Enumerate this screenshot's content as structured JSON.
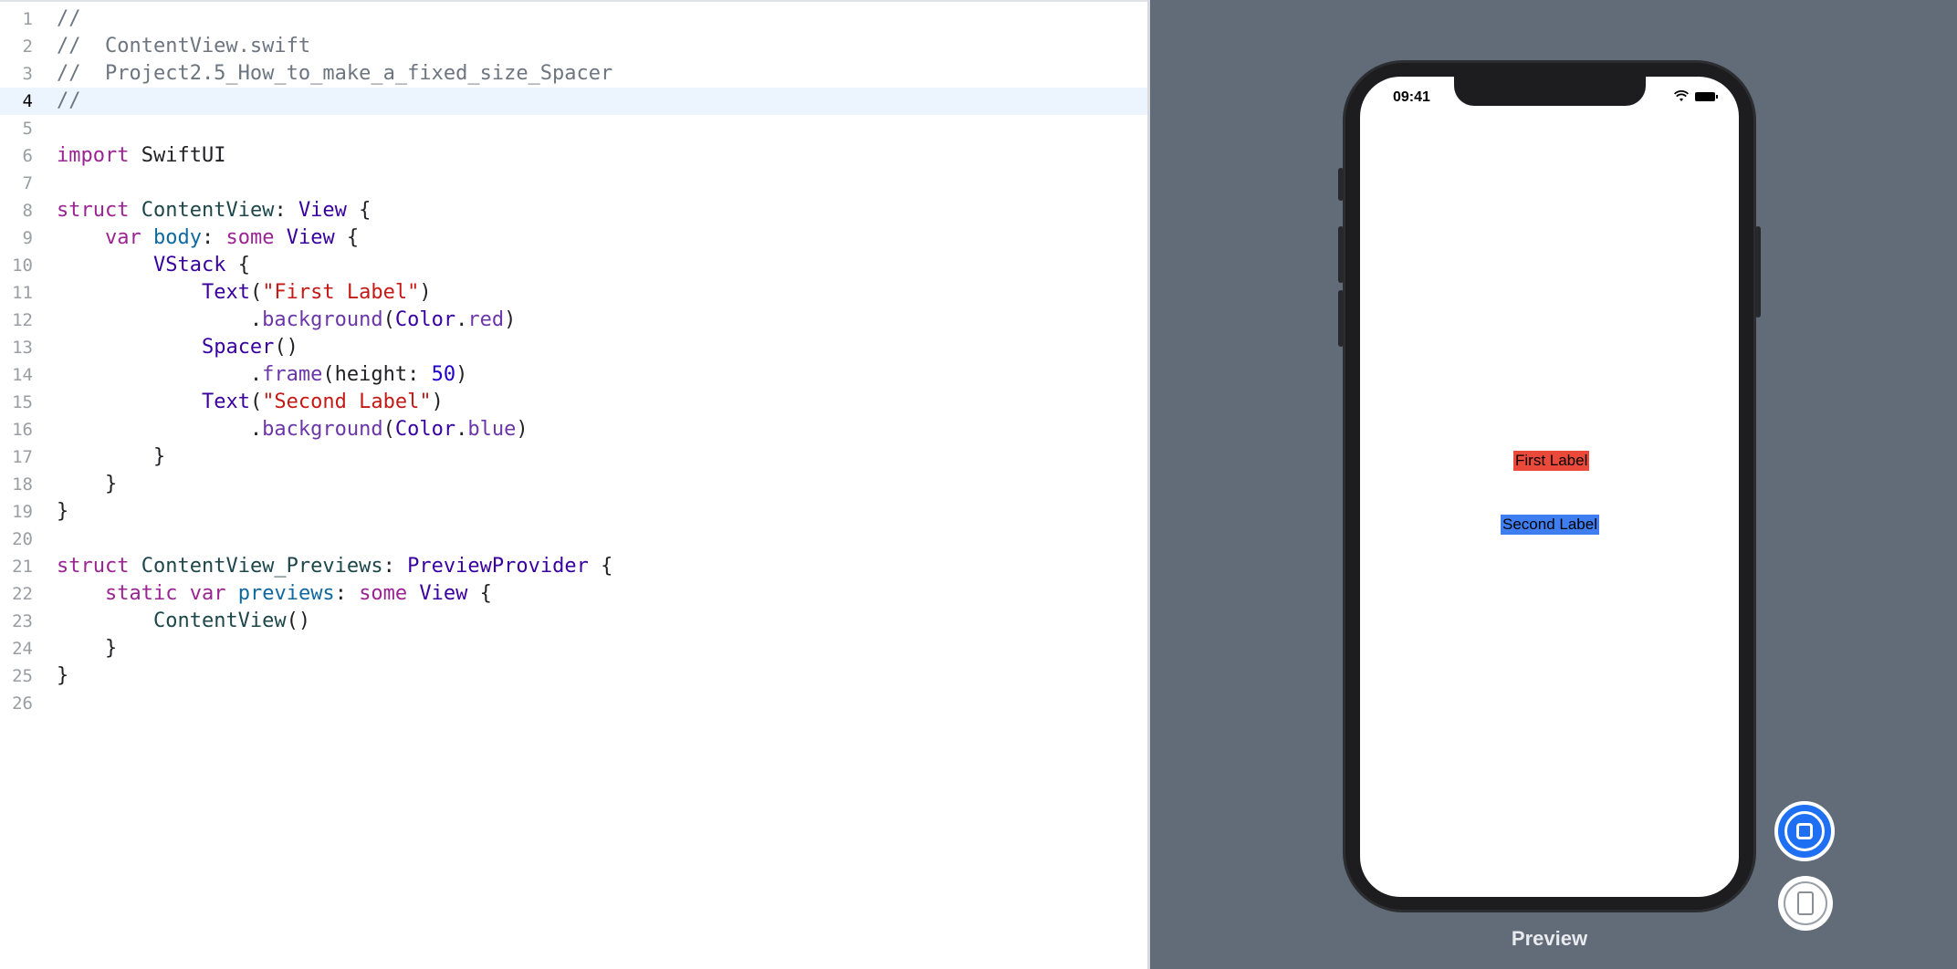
{
  "editor": {
    "current_line": 4,
    "lines": [
      {
        "n": "1",
        "tokens": [
          {
            "t": "comment",
            "v": "//"
          }
        ]
      },
      {
        "n": "2",
        "tokens": [
          {
            "t": "comment",
            "v": "//  ContentView.swift"
          }
        ]
      },
      {
        "n": "3",
        "tokens": [
          {
            "t": "comment",
            "v": "//  Project2.5_How_to_make_a_fixed_size_Spacer"
          }
        ]
      },
      {
        "n": "4",
        "tokens": [
          {
            "t": "comment",
            "v": "//"
          }
        ]
      },
      {
        "n": "5",
        "tokens": []
      },
      {
        "n": "6",
        "tokens": [
          {
            "t": "keyword",
            "v": "import"
          },
          {
            "t": "plain",
            "v": " SwiftUI"
          }
        ]
      },
      {
        "n": "7",
        "tokens": []
      },
      {
        "n": "8",
        "tokens": [
          {
            "t": "keyword",
            "v": "struct"
          },
          {
            "t": "plain",
            "v": " "
          },
          {
            "t": "type",
            "v": "ContentView"
          },
          {
            "t": "plain",
            "v": ": "
          },
          {
            "t": "typeref",
            "v": "View"
          },
          {
            "t": "plain",
            "v": " {"
          }
        ]
      },
      {
        "n": "9",
        "tokens": [
          {
            "t": "plain",
            "v": "    "
          },
          {
            "t": "keyword",
            "v": "var"
          },
          {
            "t": "plain",
            "v": " "
          },
          {
            "t": "prop",
            "v": "body"
          },
          {
            "t": "plain",
            "v": ": "
          },
          {
            "t": "keyword",
            "v": "some"
          },
          {
            "t": "plain",
            "v": " "
          },
          {
            "t": "typeref",
            "v": "View"
          },
          {
            "t": "plain",
            "v": " {"
          }
        ]
      },
      {
        "n": "10",
        "tokens": [
          {
            "t": "plain",
            "v": "        "
          },
          {
            "t": "typeref",
            "v": "VStack"
          },
          {
            "t": "plain",
            "v": " {"
          }
        ]
      },
      {
        "n": "11",
        "tokens": [
          {
            "t": "plain",
            "v": "            "
          },
          {
            "t": "typeref",
            "v": "Text"
          },
          {
            "t": "plain",
            "v": "("
          },
          {
            "t": "string",
            "v": "\"First Label\""
          },
          {
            "t": "plain",
            "v": ")"
          }
        ]
      },
      {
        "n": "12",
        "tokens": [
          {
            "t": "plain",
            "v": "                ."
          },
          {
            "t": "member",
            "v": "background"
          },
          {
            "t": "plain",
            "v": "("
          },
          {
            "t": "typeref",
            "v": "Color"
          },
          {
            "t": "plain",
            "v": "."
          },
          {
            "t": "member",
            "v": "red"
          },
          {
            "t": "plain",
            "v": ")"
          }
        ]
      },
      {
        "n": "13",
        "tokens": [
          {
            "t": "plain",
            "v": "            "
          },
          {
            "t": "typeref",
            "v": "Spacer"
          },
          {
            "t": "plain",
            "v": "()"
          }
        ]
      },
      {
        "n": "14",
        "tokens": [
          {
            "t": "plain",
            "v": "                ."
          },
          {
            "t": "member",
            "v": "frame"
          },
          {
            "t": "plain",
            "v": "(height: "
          },
          {
            "t": "number",
            "v": "50"
          },
          {
            "t": "plain",
            "v": ")"
          }
        ]
      },
      {
        "n": "15",
        "tokens": [
          {
            "t": "plain",
            "v": "            "
          },
          {
            "t": "typeref",
            "v": "Text"
          },
          {
            "t": "plain",
            "v": "("
          },
          {
            "t": "string",
            "v": "\"Second Label\""
          },
          {
            "t": "plain",
            "v": ")"
          }
        ]
      },
      {
        "n": "16",
        "tokens": [
          {
            "t": "plain",
            "v": "                ."
          },
          {
            "t": "member",
            "v": "background"
          },
          {
            "t": "plain",
            "v": "("
          },
          {
            "t": "typeref",
            "v": "Color"
          },
          {
            "t": "plain",
            "v": "."
          },
          {
            "t": "member",
            "v": "blue"
          },
          {
            "t": "plain",
            "v": ")"
          }
        ]
      },
      {
        "n": "17",
        "tokens": [
          {
            "t": "plain",
            "v": "        }"
          }
        ]
      },
      {
        "n": "18",
        "tokens": [
          {
            "t": "plain",
            "v": "    }"
          }
        ]
      },
      {
        "n": "19",
        "tokens": [
          {
            "t": "plain",
            "v": "}"
          }
        ]
      },
      {
        "n": "20",
        "tokens": []
      },
      {
        "n": "21",
        "tokens": [
          {
            "t": "keyword",
            "v": "struct"
          },
          {
            "t": "plain",
            "v": " "
          },
          {
            "t": "type",
            "v": "ContentView_Previews"
          },
          {
            "t": "plain",
            "v": ": "
          },
          {
            "t": "typeref",
            "v": "PreviewProvider"
          },
          {
            "t": "plain",
            "v": " {"
          }
        ]
      },
      {
        "n": "22",
        "tokens": [
          {
            "t": "plain",
            "v": "    "
          },
          {
            "t": "keyword",
            "v": "static"
          },
          {
            "t": "plain",
            "v": " "
          },
          {
            "t": "keyword",
            "v": "var"
          },
          {
            "t": "plain",
            "v": " "
          },
          {
            "t": "prop",
            "v": "previews"
          },
          {
            "t": "plain",
            "v": ": "
          },
          {
            "t": "keyword",
            "v": "some"
          },
          {
            "t": "plain",
            "v": " "
          },
          {
            "t": "typeref",
            "v": "View"
          },
          {
            "t": "plain",
            "v": " {"
          }
        ]
      },
      {
        "n": "23",
        "tokens": [
          {
            "t": "plain",
            "v": "        "
          },
          {
            "t": "type",
            "v": "ContentView"
          },
          {
            "t": "plain",
            "v": "()"
          }
        ]
      },
      {
        "n": "24",
        "tokens": [
          {
            "t": "plain",
            "v": "    }"
          }
        ]
      },
      {
        "n": "25",
        "tokens": [
          {
            "t": "plain",
            "v": "}"
          }
        ]
      },
      {
        "n": "26",
        "tokens": []
      }
    ]
  },
  "preview": {
    "device": {
      "status_time": "09:41",
      "wifi_icon": "wifi-icon",
      "battery_icon": "battery-icon"
    },
    "labels": {
      "first": "First Label",
      "second": "Second Label"
    },
    "colors": {
      "first_background": "#eb4a3a",
      "second_background": "#3f7ef0",
      "canvas": "#626b78"
    },
    "live_button_icon": "live-preview-icon",
    "device_button_icon": "device-preview-icon",
    "caption": "Preview"
  }
}
